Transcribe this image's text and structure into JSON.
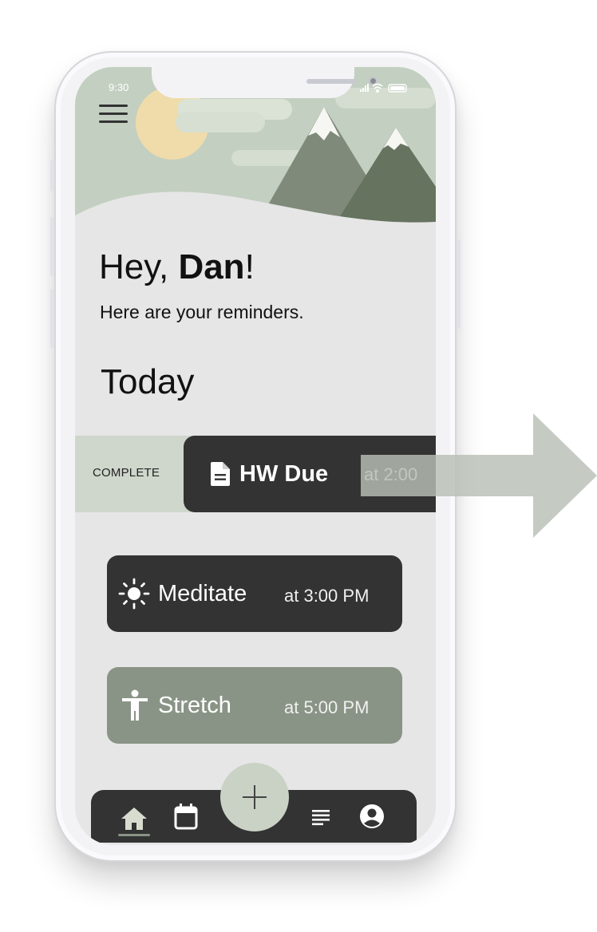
{
  "status_bar": {
    "time": "9:30"
  },
  "greeting": {
    "prefix": "Hey, ",
    "name": "Dan",
    "suffix": "!"
  },
  "subtitle": "Here are your reminders.",
  "section_title": "Today",
  "swipe_action": {
    "label": "COMPLETE"
  },
  "reminders": [
    {
      "title": "HW Due",
      "time": "at 2:00",
      "icon": "document-icon",
      "state": "swiping"
    },
    {
      "title": "Meditate",
      "time": "at 3:00 PM",
      "icon": "sun-icon"
    },
    {
      "title": "Stretch",
      "time": "at 5:00 PM",
      "icon": "person-stretch-icon"
    }
  ],
  "bottom_nav": {
    "items": [
      "home-icon",
      "calendar-icon",
      "add-icon",
      "list-icon",
      "account-icon"
    ],
    "active": "home-icon"
  },
  "colors": {
    "dark_card": "#333333",
    "sage_card": "#8a9486",
    "swipe_bg": "#cfd7cc",
    "screen_bg": "#e6e6e6",
    "fab": "#c9d2c5"
  }
}
